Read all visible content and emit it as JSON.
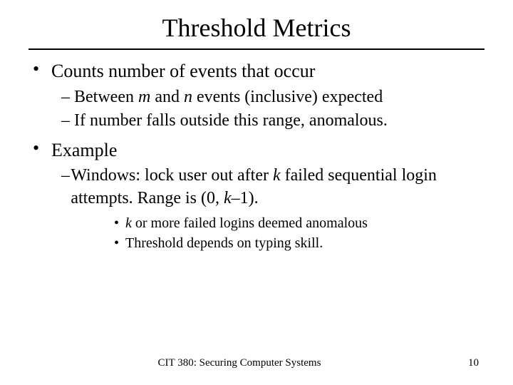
{
  "title": "Threshold Metrics",
  "bullets": {
    "b1": {
      "text": "Counts number of events that occur",
      "sub": {
        "s1a": "Between ",
        "s1_m": "m",
        "s1b": " and ",
        "s1_n": "n",
        "s1c": " events (inclusive) expected",
        "s2": "If number falls outside this range, anomalous."
      }
    },
    "b2": {
      "text": "Example",
      "sub": {
        "s1a": "Windows: lock user out after ",
        "s1_k": "k",
        "s1b": " failed sequential login attempts. Range is (0, ",
        "s1_k2": "k",
        "s1c": "–1).",
        "sub2": {
          "t1_k": "k",
          "t1": " or more failed logins deemed anomalous",
          "t2": "Threshold depends on typing skill."
        }
      }
    }
  },
  "footer": {
    "course": "CIT 380: Securing Computer Systems",
    "page": "10"
  }
}
